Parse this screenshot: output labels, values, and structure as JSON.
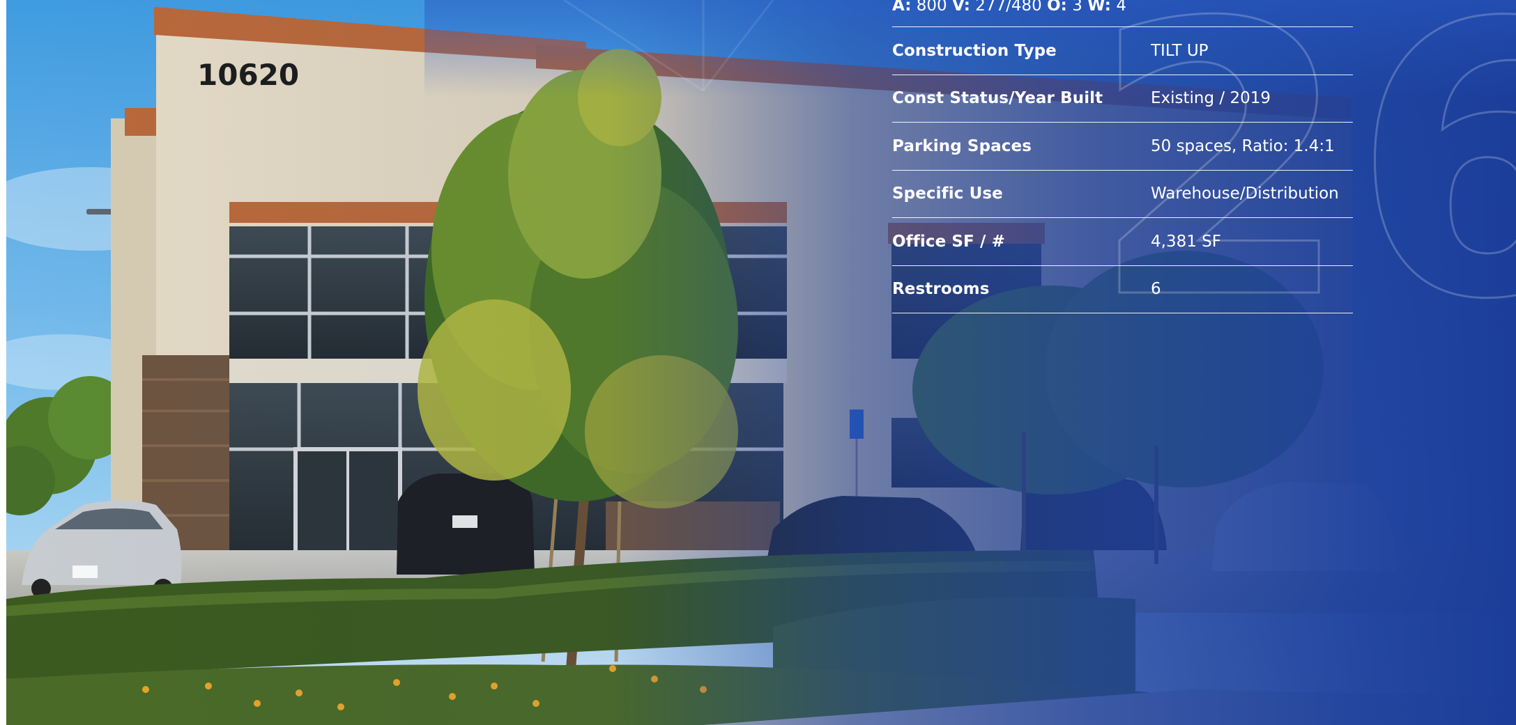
{
  "building": {
    "address_number": "10620"
  },
  "electrical": {
    "a_label": "A:",
    "a_value": "800",
    "v_label": "V:",
    "v_value": "277/480",
    "o_label": "O:",
    "o_value": "3",
    "w_label": "W:",
    "w_value": "4"
  },
  "specs": [
    {
      "label": "Construction Type",
      "value": "TILT UP"
    },
    {
      "label": "Const Status/Year Built",
      "value": "Existing / 2019"
    },
    {
      "label": "Parking Spaces",
      "value": "50 spaces, Ratio: 1.4:1"
    },
    {
      "label": "Specific Use",
      "value": "Warehouse/Distribution"
    },
    {
      "label": "Office SF / #",
      "value": "4,381 SF"
    },
    {
      "label": "Restrooms",
      "value": "6"
    }
  ],
  "decor": {
    "outline_digits": "26"
  },
  "colors": {
    "overlay_blue": "#1c3f9c",
    "sky": "#4aa6e8",
    "building_wall": "#d9cdb6",
    "trim_orange": "#b9683a",
    "hedge": "#3d5a1f"
  }
}
